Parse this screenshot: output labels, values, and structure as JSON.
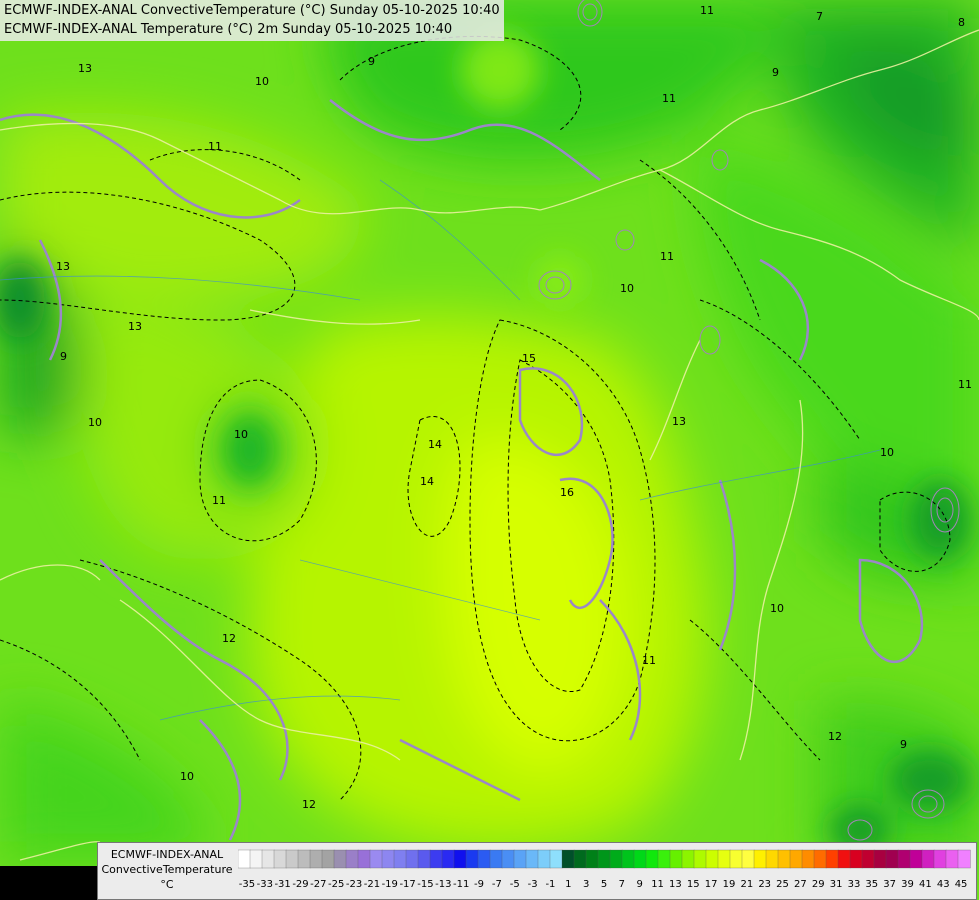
{
  "header": {
    "line1": "ECMWF-INDEX-ANAL ConvectiveTemperature (°C) Sunday 05-10-2025 10:40",
    "line2": "ECMWF-INDEX-ANAL Temperature (°C) 2m Sunday 05-10-2025 10:40"
  },
  "legend": {
    "model": "ECMWF-INDEX-ANAL",
    "variable": "ConvectiveTemperature",
    "unit": "°C",
    "tick_labels": [
      "-35",
      "-33",
      "-31",
      "-29",
      "-27",
      "-25",
      "-23",
      "-21",
      "-19",
      "-17",
      "-15",
      "-13",
      "-11",
      "-9",
      "-7",
      "-5",
      "-3",
      "-1",
      "1",
      "3",
      "5",
      "7",
      "9",
      "11",
      "13",
      "15",
      "17",
      "19",
      "21",
      "23",
      "25",
      "27",
      "29",
      "31",
      "33",
      "35",
      "37",
      "39",
      "41",
      "43",
      "45"
    ],
    "colors": [
      "#ffffff",
      "#f4f4f4",
      "#e6e6e6",
      "#d8d8d8",
      "#cacaca",
      "#bcbcbc",
      "#aeaeae",
      "#a3a3a3",
      "#9a8fb0",
      "#9a7fc8",
      "#9870d8",
      "#9a8af0",
      "#8d86f0",
      "#7f7ff0",
      "#7070ee",
      "#5a5aee",
      "#3c3cf0",
      "#2a2af2",
      "#1010ee",
      "#1a3af0",
      "#2b5bf2",
      "#3a7af2",
      "#4a8ef4",
      "#5aa3f6",
      "#6ab8f8",
      "#7ccdfa",
      "#8edffc",
      "#00502a",
      "#006a1e",
      "#008018",
      "#00961a",
      "#00ac1a",
      "#00c41c",
      "#00d818",
      "#10e80c",
      "#3af00c",
      "#66f000",
      "#8cf400",
      "#aefa00",
      "#ccfe00",
      "#e6ff10",
      "#f8ff30",
      "#ffff40",
      "#fff000",
      "#ffd800",
      "#ffc000",
      "#ffa800",
      "#ff8c00",
      "#ff6c00",
      "#ff4000",
      "#f01010",
      "#d80020",
      "#c00030",
      "#a80040",
      "#a00050",
      "#b00070",
      "#c00098",
      "#d020c0",
      "#e040e0",
      "#ea60f0",
      "#f080ff"
    ]
  },
  "map": {
    "contour_labels": [
      "13",
      "10",
      "9",
      "11",
      "11",
      "9",
      "7",
      "8",
      "13",
      "11",
      "13",
      "9",
      "15",
      "13",
      "14",
      "14",
      "16",
      "11",
      "10",
      "10",
      "11",
      "12",
      "10",
      "10",
      "12",
      "11",
      "10",
      "9",
      "11",
      "12",
      "10"
    ]
  }
}
